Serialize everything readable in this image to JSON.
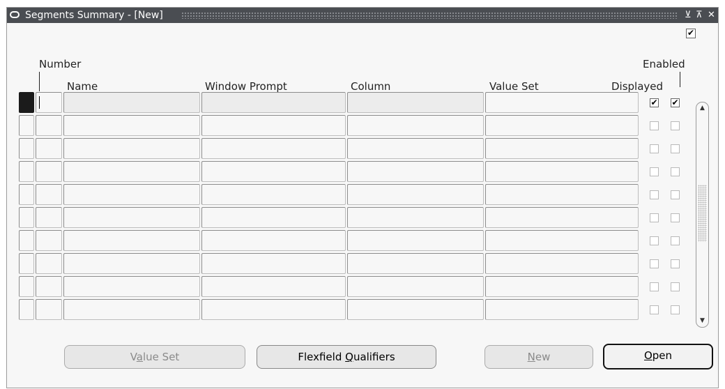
{
  "window": {
    "title": "Segments Summary - [New]"
  },
  "top_checkbox": {
    "checked": true
  },
  "columns": {
    "number": "Number",
    "name": "Name",
    "window_prompt": "Window Prompt",
    "column": "Column",
    "value_set": "Value Set",
    "displayed": "Displayed",
    "enabled": "Enabled"
  },
  "rows": [
    {
      "number": "",
      "name": "",
      "window_prompt": "",
      "column": "",
      "value_set": "",
      "displayed": true,
      "enabled": true
    },
    {
      "number": "",
      "name": "",
      "window_prompt": "",
      "column": "",
      "value_set": "",
      "displayed": false,
      "enabled": false
    },
    {
      "number": "",
      "name": "",
      "window_prompt": "",
      "column": "",
      "value_set": "",
      "displayed": false,
      "enabled": false
    },
    {
      "number": "",
      "name": "",
      "window_prompt": "",
      "column": "",
      "value_set": "",
      "displayed": false,
      "enabled": false
    },
    {
      "number": "",
      "name": "",
      "window_prompt": "",
      "column": "",
      "value_set": "",
      "displayed": false,
      "enabled": false
    },
    {
      "number": "",
      "name": "",
      "window_prompt": "",
      "column": "",
      "value_set": "",
      "displayed": false,
      "enabled": false
    },
    {
      "number": "",
      "name": "",
      "window_prompt": "",
      "column": "",
      "value_set": "",
      "displayed": false,
      "enabled": false
    },
    {
      "number": "",
      "name": "",
      "window_prompt": "",
      "column": "",
      "value_set": "",
      "displayed": false,
      "enabled": false
    },
    {
      "number": "",
      "name": "",
      "window_prompt": "",
      "column": "",
      "value_set": "",
      "displayed": false,
      "enabled": false
    },
    {
      "number": "",
      "name": "",
      "window_prompt": "",
      "column": "",
      "value_set": "",
      "displayed": false,
      "enabled": false
    }
  ],
  "buttons": {
    "value_set_pre": "V",
    "value_set_u": "a",
    "value_set_post": "lue Set",
    "flex_pre": "Flexfield ",
    "flex_u": "Q",
    "flex_post": "ualifiers",
    "new_pre": "",
    "new_u": "N",
    "new_post": "ew",
    "open_pre": "",
    "open_u": "O",
    "open_post": "pen"
  }
}
